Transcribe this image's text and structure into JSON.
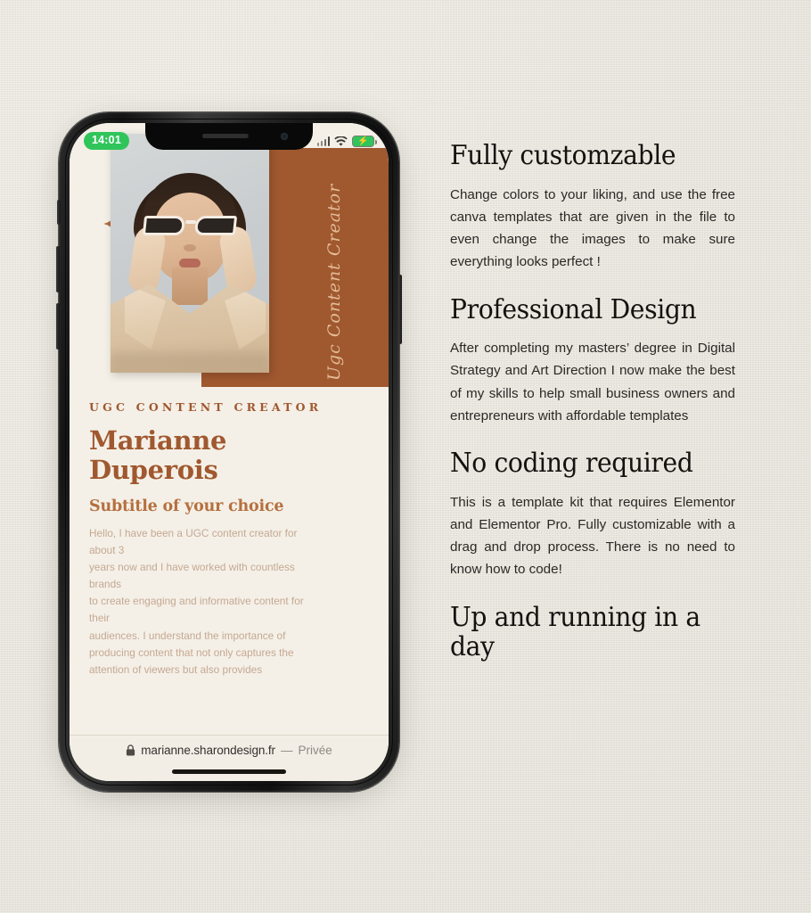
{
  "colors": {
    "page_background": "#e7e4db",
    "terracotta": "#a0582f",
    "accent_light": "#b5703f",
    "screen_cream": "#f4f0e7",
    "status_green": "#2fc55b",
    "heading_dark": "#14120f"
  },
  "phone": {
    "status_bar": {
      "time": "14:01",
      "signal_icon": "signal-bars-icon",
      "wifi_icon": "wifi-icon",
      "battery_icon": "battery-charging-icon",
      "battery_bolt": "⚡"
    },
    "site": {
      "hero": {
        "vertical_script": "Ugc Content Creator",
        "sparkle_icon": "sparkle-icon",
        "photo_alt": "portrait-photo"
      },
      "eyebrow": "UGC CONTENT CREATOR",
      "name": "Marianne Duperois",
      "name_line1": "Marianne",
      "name_line2": "Duperois",
      "subtitle": "Subtitle of your choice",
      "paragraph_lines": [
        "Hello, I have been a UGC content creator for",
        "about 3",
        "years now and I have worked with countless",
        "brands",
        "to create engaging and informative content for",
        "their",
        "audiences. I understand the importance of",
        "producing content that not only captures the",
        "attention of viewers but also provides"
      ]
    },
    "browser_bar": {
      "lock_icon": "lock-icon",
      "url": "marianne.sharondesign.fr",
      "separator": "—",
      "private_label": "Privée"
    }
  },
  "features": [
    {
      "title": "Fully customzable",
      "body": "Change colors to your liking, and use the free canva templates that are given in the file to even change the images to make sure everything looks perfect !"
    },
    {
      "title": "Professional Design",
      "body": "After completing my masters’ degree in Digital Strategy and Art Direction I now make the best of my skills to help small business owners and entrepreneurs with affordable templates"
    },
    {
      "title": "No coding required",
      "body": "This is a template kit that requires Elementor and Elementor Pro. Fully customizable with a drag and drop process. There is no need to know how to code!"
    },
    {
      "title": "Up and running in a day",
      "body": ""
    }
  ]
}
